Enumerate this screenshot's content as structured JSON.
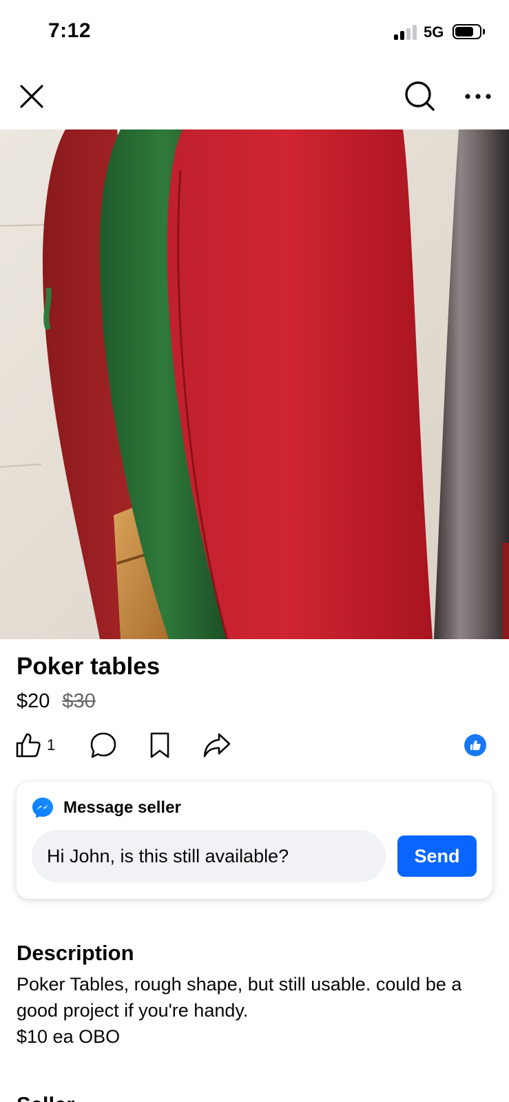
{
  "status_bar": {
    "time": "7:12",
    "network": "5G",
    "signal_bars_filled": 2,
    "signal_bars_total": 4,
    "battery_fraction": 0.75
  },
  "nav": {
    "close_icon": "close-icon",
    "search_icon": "search-icon",
    "more_icon": "more-horizontal-icon"
  },
  "listing": {
    "title": "Poker tables",
    "price": "$20",
    "original_price": "$30",
    "photo_subject": "poker-table-tops-photo"
  },
  "actions": {
    "like_count": "1",
    "icons": [
      "thumbs-up-icon",
      "comment-icon",
      "bookmark-icon",
      "share-icon",
      "like-reaction-icon"
    ]
  },
  "message": {
    "heading": "Message seller",
    "input_value": "Hi John, is this still available?",
    "send_label": "Send"
  },
  "description": {
    "heading": "Description",
    "text": "Poker Tables, rough shape, but still usable.  could be a good project if you're handy.\n$10 ea OBO"
  },
  "seller": {
    "heading": "Seller"
  },
  "colors": {
    "accent": "#0866ff",
    "like_bubble": "#1877f2",
    "input_bg": "#f0f2f5",
    "muted_text": "#65676b"
  }
}
